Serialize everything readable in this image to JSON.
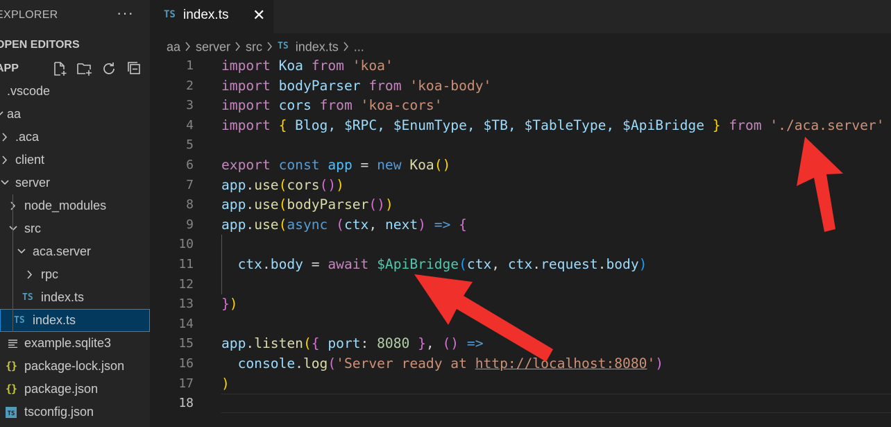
{
  "sidebar": {
    "title": "EXPLORER",
    "more": "···",
    "section": "OPEN EDITORS",
    "workspace": "APP",
    "tree": [
      {
        "label": ".vscode"
      },
      {
        "label": "aa"
      },
      {
        "label": ".aca"
      },
      {
        "label": "client"
      },
      {
        "label": "server"
      },
      {
        "label": "node_modules"
      },
      {
        "label": "src"
      },
      {
        "label": "aca.server"
      },
      {
        "label": "rpc"
      },
      {
        "label": "index.ts",
        "icon": "TS"
      },
      {
        "label": "index.ts",
        "icon": "TS"
      },
      {
        "label": "example.sqlite3"
      },
      {
        "label": "package-lock.json",
        "icon": "{}"
      },
      {
        "label": "package.json",
        "icon": "{}"
      },
      {
        "label": "tsconfig.json",
        "icon": "TS"
      }
    ]
  },
  "tab": {
    "icon": "TS",
    "label": "index.ts",
    "close": "✕"
  },
  "breadcrumb": [
    "aa",
    "server",
    "src",
    "index.ts",
    "..."
  ],
  "breadcrumb_icon": "TS",
  "editor": {
    "line_numbers": [
      "1",
      "2",
      "3",
      "4",
      "5",
      "6",
      "7",
      "8",
      "9",
      "10",
      "11",
      "12",
      "13",
      "14",
      "15",
      "16",
      "17",
      "18"
    ],
    "lines": [
      [
        {
          "t": "import",
          "c": "kw"
        },
        {
          "t": " Koa ",
          "c": "vr"
        },
        {
          "t": "from",
          "c": "kw"
        },
        {
          "t": " ",
          "c": ""
        },
        {
          "t": "'koa'",
          "c": "str"
        }
      ],
      [
        {
          "t": "import",
          "c": "kw"
        },
        {
          "t": " bodyParser ",
          "c": "vr"
        },
        {
          "t": "from",
          "c": "kw"
        },
        {
          "t": " ",
          "c": ""
        },
        {
          "t": "'koa-body'",
          "c": "str"
        }
      ],
      [
        {
          "t": "import",
          "c": "kw"
        },
        {
          "t": " cors ",
          "c": "vr"
        },
        {
          "t": "from",
          "c": "kw"
        },
        {
          "t": " ",
          "c": ""
        },
        {
          "t": "'koa-cors'",
          "c": "str"
        }
      ],
      [
        {
          "t": "import",
          "c": "kw"
        },
        {
          "t": " ",
          "c": ""
        },
        {
          "t": "{",
          "c": "b1"
        },
        {
          "t": " Blog, $RPC, $EnumType, $TB, $TableType, ",
          "c": "vr"
        },
        {
          "t": "$ApiBridge",
          "c": "vr"
        },
        {
          "t": " ",
          "c": ""
        },
        {
          "t": "}",
          "c": "b1"
        },
        {
          "t": " ",
          "c": ""
        },
        {
          "t": "from",
          "c": "kw"
        },
        {
          "t": " ",
          "c": ""
        },
        {
          "t": "'./aca.server'",
          "c": "str"
        }
      ],
      [],
      [
        {
          "t": "export",
          "c": "kw"
        },
        {
          "t": " ",
          "c": ""
        },
        {
          "t": "const",
          "c": "st"
        },
        {
          "t": " ",
          "c": ""
        },
        {
          "t": "app",
          "c": "cn"
        },
        {
          "t": " = ",
          "c": ""
        },
        {
          "t": "new",
          "c": "st"
        },
        {
          "t": " ",
          "c": ""
        },
        {
          "t": "Koa",
          "c": "fn"
        },
        {
          "t": "()",
          "c": "b1"
        }
      ],
      [
        {
          "t": "app",
          "c": "vr"
        },
        {
          "t": ".",
          "c": ""
        },
        {
          "t": "use",
          "c": "fn"
        },
        {
          "t": "(",
          "c": "b1"
        },
        {
          "t": "cors",
          "c": "fn"
        },
        {
          "t": "()",
          "c": "b2"
        },
        {
          "t": ")",
          "c": "b1"
        }
      ],
      [
        {
          "t": "app",
          "c": "vr"
        },
        {
          "t": ".",
          "c": ""
        },
        {
          "t": "use",
          "c": "fn"
        },
        {
          "t": "(",
          "c": "b1"
        },
        {
          "t": "bodyParser",
          "c": "fn"
        },
        {
          "t": "()",
          "c": "b2"
        },
        {
          "t": ")",
          "c": "b1"
        }
      ],
      [
        {
          "t": "app",
          "c": "vr"
        },
        {
          "t": ".",
          "c": ""
        },
        {
          "t": "use",
          "c": "fn"
        },
        {
          "t": "(",
          "c": "b1"
        },
        {
          "t": "async",
          "c": "st"
        },
        {
          "t": " ",
          "c": ""
        },
        {
          "t": "(",
          "c": "b2"
        },
        {
          "t": "ctx",
          "c": "vr"
        },
        {
          "t": ", ",
          "c": ""
        },
        {
          "t": "next",
          "c": "vr"
        },
        {
          "t": ")",
          "c": "b2"
        },
        {
          "t": " ",
          "c": ""
        },
        {
          "t": "=>",
          "c": "st"
        },
        {
          "t": " ",
          "c": ""
        },
        {
          "t": "{",
          "c": "b2"
        }
      ],
      [],
      [
        {
          "t": "  ",
          "c": ""
        },
        {
          "t": "ctx",
          "c": "vr"
        },
        {
          "t": ".",
          "c": ""
        },
        {
          "t": "body",
          "c": "vr"
        },
        {
          "t": " = ",
          "c": ""
        },
        {
          "t": "await",
          "c": "kw"
        },
        {
          "t": " ",
          "c": ""
        },
        {
          "t": "$ApiBridge",
          "c": "ty"
        },
        {
          "t": "(",
          "c": "b3"
        },
        {
          "t": "ctx",
          "c": "vr"
        },
        {
          "t": ", ",
          "c": ""
        },
        {
          "t": "ctx",
          "c": "vr"
        },
        {
          "t": ".",
          "c": ""
        },
        {
          "t": "request",
          "c": "vr"
        },
        {
          "t": ".",
          "c": ""
        },
        {
          "t": "body",
          "c": "vr"
        },
        {
          "t": ")",
          "c": "b3"
        }
      ],
      [],
      [
        {
          "t": "}",
          "c": "b2"
        },
        {
          "t": ")",
          "c": "b1"
        }
      ],
      [],
      [
        {
          "t": "app",
          "c": "vr"
        },
        {
          "t": ".",
          "c": ""
        },
        {
          "t": "listen",
          "c": "fn"
        },
        {
          "t": "(",
          "c": "b1"
        },
        {
          "t": "{",
          "c": "b2"
        },
        {
          "t": " ",
          "c": ""
        },
        {
          "t": "port",
          "c": "vr"
        },
        {
          "t": ": ",
          "c": ""
        },
        {
          "t": "8080",
          "c": "num"
        },
        {
          "t": " ",
          "c": ""
        },
        {
          "t": "}",
          "c": "b2"
        },
        {
          "t": ", ",
          "c": ""
        },
        {
          "t": "()",
          "c": "b2"
        },
        {
          "t": " ",
          "c": ""
        },
        {
          "t": "=>",
          "c": "st"
        }
      ],
      [
        {
          "t": "  ",
          "c": ""
        },
        {
          "t": "console",
          "c": "vr"
        },
        {
          "t": ".",
          "c": ""
        },
        {
          "t": "log",
          "c": "fn"
        },
        {
          "t": "(",
          "c": "b2"
        },
        {
          "t": "'Server ready at ",
          "c": "str"
        },
        {
          "t": "http://localhost:8080",
          "c": "str link"
        },
        {
          "t": "'",
          "c": "str"
        },
        {
          "t": ")",
          "c": "b2"
        }
      ],
      [
        {
          "t": ")",
          "c": "b1"
        }
      ],
      []
    ],
    "active_line": 18
  },
  "colors": {
    "arrow": "#f0302b",
    "sidebar_bg": "#252526",
    "editor_bg": "#1e1e1e",
    "selection": "#04395e"
  }
}
